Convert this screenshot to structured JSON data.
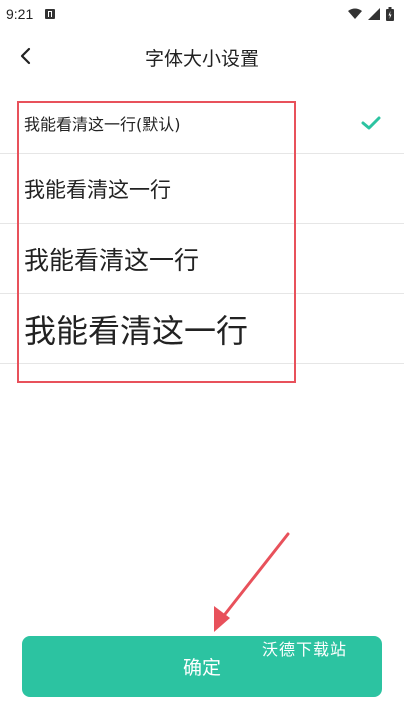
{
  "status_bar": {
    "time": "9:21"
  },
  "header": {
    "title": "字体大小设置"
  },
  "options": [
    {
      "label": "我能看清这一行(默认)",
      "selected": true
    },
    {
      "label": "我能看清这一行",
      "selected": false
    },
    {
      "label": "我能看清这一行",
      "selected": false
    },
    {
      "label": "我能看清这一行",
      "selected": false
    }
  ],
  "confirm_button": {
    "label": "确定"
  },
  "watermark": {
    "text": "沃德下载站"
  },
  "colors": {
    "accent": "#2cc3a1",
    "annotation_red": "#e8515b",
    "check": "#2cc3a1"
  },
  "icons": {
    "back": "chevron-left-icon",
    "selected": "check-icon",
    "wifi": "wifi-icon",
    "signal": "signal-icon",
    "battery": "battery-icon"
  }
}
